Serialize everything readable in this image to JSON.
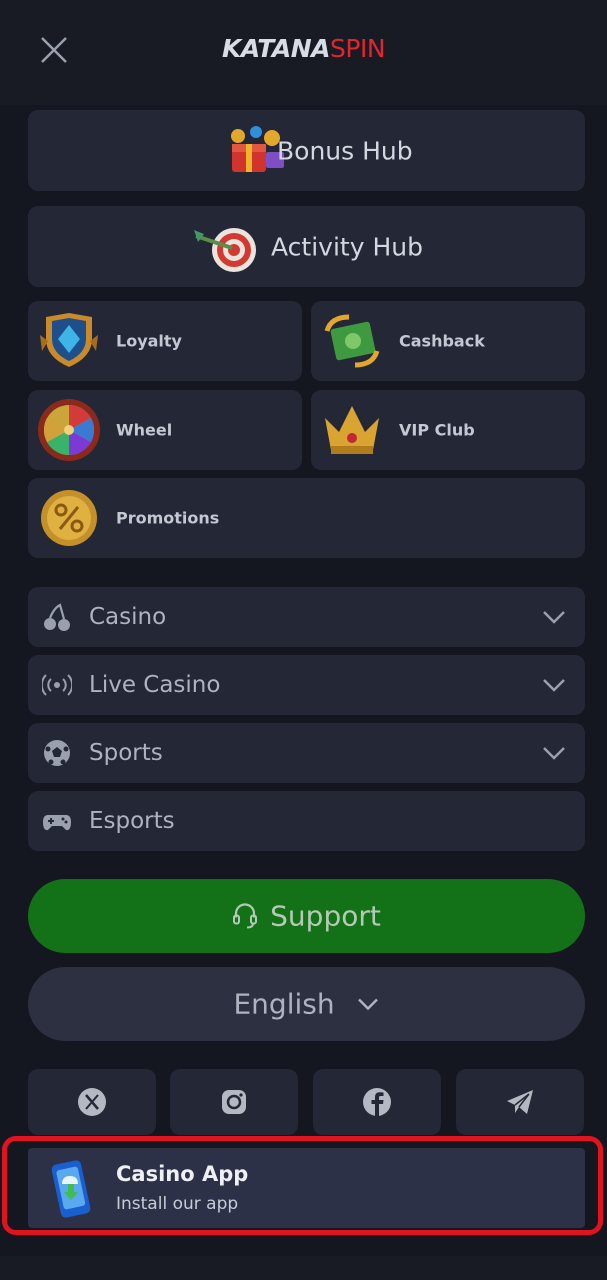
{
  "header": {
    "logo_left": "KATANA",
    "logo_right": "SPIN"
  },
  "hubs": [
    {
      "label": "Bonus Hub",
      "icon": "gift-box-icon"
    },
    {
      "label": "Activity Hub",
      "icon": "dart-target-icon"
    }
  ],
  "tiles": [
    {
      "label": "Loyalty",
      "icon": "shield-badge-icon"
    },
    {
      "label": "Cashback",
      "icon": "cash-refresh-icon"
    },
    {
      "label": "Wheel",
      "icon": "fortune-wheel-icon"
    },
    {
      "label": "VIP Club",
      "icon": "crown-icon"
    },
    {
      "label": "Promotions",
      "icon": "percent-coin-icon"
    }
  ],
  "menu": [
    {
      "label": "Casino",
      "icon": "cherries-icon",
      "expandable": true
    },
    {
      "label": "Live Casino",
      "icon": "broadcast-icon",
      "expandable": true
    },
    {
      "label": "Sports",
      "icon": "soccer-ball-icon",
      "expandable": true
    },
    {
      "label": "Esports",
      "icon": "gamepad-icon",
      "expandable": false
    }
  ],
  "support": {
    "label": "Support",
    "icon": "headset-icon"
  },
  "language": {
    "label": "English"
  },
  "socials": [
    {
      "name": "x-icon"
    },
    {
      "name": "instagram-icon"
    },
    {
      "name": "facebook-icon"
    },
    {
      "name": "telegram-icon"
    }
  ],
  "app_banner": {
    "title": "Casino App",
    "subtitle": "Install our app",
    "icon": "phone-download-icon"
  },
  "colors": {
    "background": "#141720",
    "card": "#232736",
    "support_green": "#137217",
    "logo_red": "#e0262d",
    "highlight_red": "#e0141e"
  }
}
